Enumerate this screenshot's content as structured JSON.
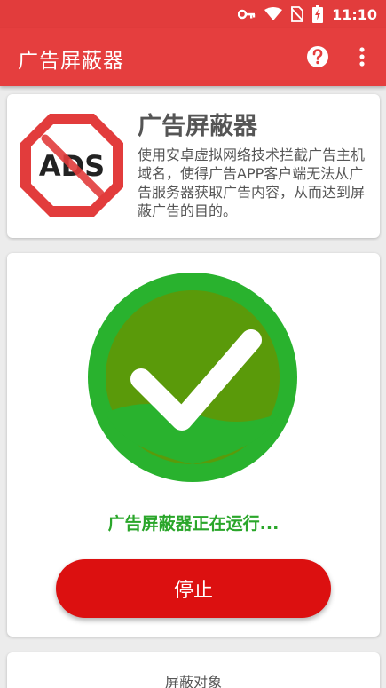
{
  "statusbar": {
    "time": "11:10",
    "icons": [
      "key-icon",
      "wifi-icon",
      "no-sim-icon",
      "battery-charging-icon"
    ]
  },
  "appbar": {
    "title": "广告屏蔽器",
    "help_icon": "help-circle-icon",
    "menu_icon": "more-vert-icon"
  },
  "info_card": {
    "logo_text": "ADS",
    "title": "广告屏蔽器",
    "description": "使用安卓虚拟网络技术拦截广告主机域名，使得广告APP客户端无法从广告服务器获取广告内容，从而达到屏蔽广告的目的。"
  },
  "status_card": {
    "status_icon": "check-circle-icon",
    "status_text": "广告屏蔽器正在运行...",
    "stop_label": "停止"
  },
  "target_card": {
    "title": "屏蔽对象"
  },
  "colors": {
    "appbar": "#e53e3e",
    "running_green": "#2aa62a",
    "stop_red": "#dc1010"
  }
}
